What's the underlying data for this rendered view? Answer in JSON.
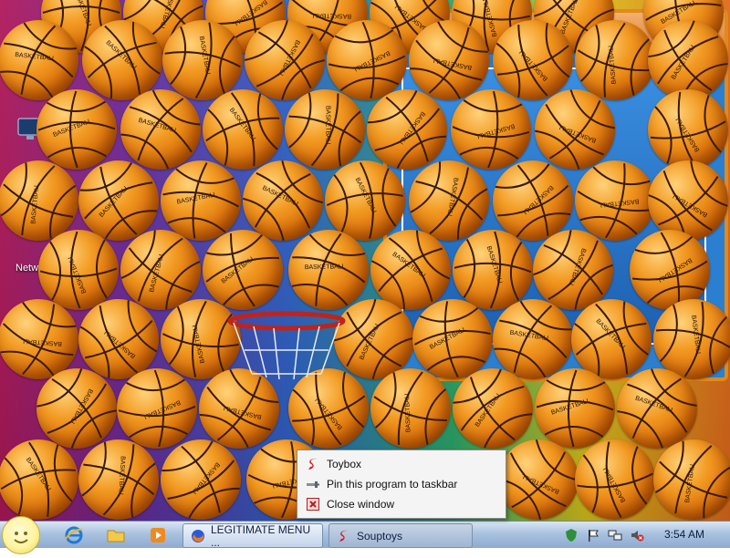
{
  "desktop": {
    "network_label": "Netw",
    "colors": {
      "ball": "#f29a22",
      "ball_seam": "#3a1a05",
      "court": "#2a7fd0",
      "frame": "#e08a1a"
    },
    "ball_label": "BASKETBALL"
  },
  "context_menu": {
    "items": [
      {
        "label": "Toybox",
        "icon": "souptoys-icon"
      },
      {
        "label": "Pin this program to taskbar",
        "icon": "pin-icon"
      },
      {
        "label": "Close window",
        "icon": "close-window-icon"
      }
    ]
  },
  "taskbar": {
    "quick_launch": [
      "ie-icon",
      "folder-icon",
      "media-player-icon"
    ],
    "buttons": [
      {
        "label": "LEGITIMATE MENU ...",
        "icon": "firefox-icon",
        "active": false
      },
      {
        "label": "Souptoys",
        "icon": "souptoys-icon",
        "active": true
      }
    ],
    "tray_icons": [
      "shield-icon",
      "flag-icon",
      "network-icon",
      "volume-muted-icon"
    ],
    "clock": "3:54 AM"
  }
}
